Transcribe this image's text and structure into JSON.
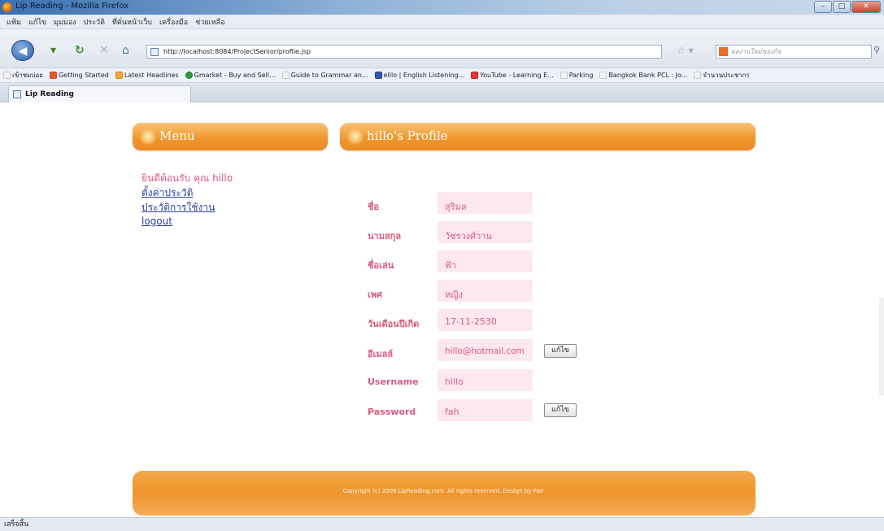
{
  "window": {
    "title": "Lip Reading - Mozilla Firefox",
    "min": "–",
    "max": "□",
    "close": "✕"
  },
  "menubar": [
    "แฟ้ม",
    "แก้ไข",
    "มุมมอง",
    "ประวัติ",
    "ที่คั่นหน้าเว็บ",
    "เครื่องมือ",
    "ช่วยเหลือ"
  ],
  "nav": {
    "url": "http://localhost:8084/ProjectSenior/profile.jsp",
    "search_placeholder": "ผลงานใหม่ของกิจ"
  },
  "bookmarks": [
    "เข้าชมบ่อย",
    "Getting Started",
    "Latest Headlines",
    "Gmarket - Buy and Sell...",
    "Guide to Grammar an...",
    "elllo | English Listening...",
    "YouTube - Learning E...",
    "Parking",
    "Bangkok Bank PCL : Jo...",
    "จำนวนประชากร"
  ],
  "tab": {
    "label": "Lip Reading"
  },
  "menu_panel": {
    "title": "Menu",
    "welcome": "ยินดีต้อนรับ คุณ hillo",
    "links": [
      "ตั้งค่าประวัติ",
      "ประวัติการใช้งาน",
      "logout"
    ]
  },
  "profile": {
    "title": "hillo's Profile",
    "fields": [
      {
        "label": "ชื่อ",
        "value": "สุริมล"
      },
      {
        "label": "นามสกุล",
        "value": "วัชรวงศ์วาน"
      },
      {
        "label": "ชื่อเล่น",
        "value": "ฟ้า"
      },
      {
        "label": "เพศ",
        "value": "หญิง"
      },
      {
        "label": "วันเดือนปีเกิด",
        "value": "17-11-2530"
      },
      {
        "label": "อีเมลล์",
        "value": "hillo@hotmail.com",
        "button": "แก้ไข"
      },
      {
        "label": "Username",
        "value": "hillo"
      },
      {
        "label": "Password",
        "value": "fah",
        "button": "แก้ไข"
      }
    ]
  },
  "footer": {
    "copyright": "Copyright (c) 2009 LipReading.com. All rights reserved. Design by Pair."
  },
  "status": {
    "text": "เสร็จสิ้น"
  },
  "colors": {
    "accent_orange": "#f0972f",
    "label_pink": "#d95a7e",
    "field_bg": "#fde8ef",
    "link_blue": "#2a3f9e"
  }
}
